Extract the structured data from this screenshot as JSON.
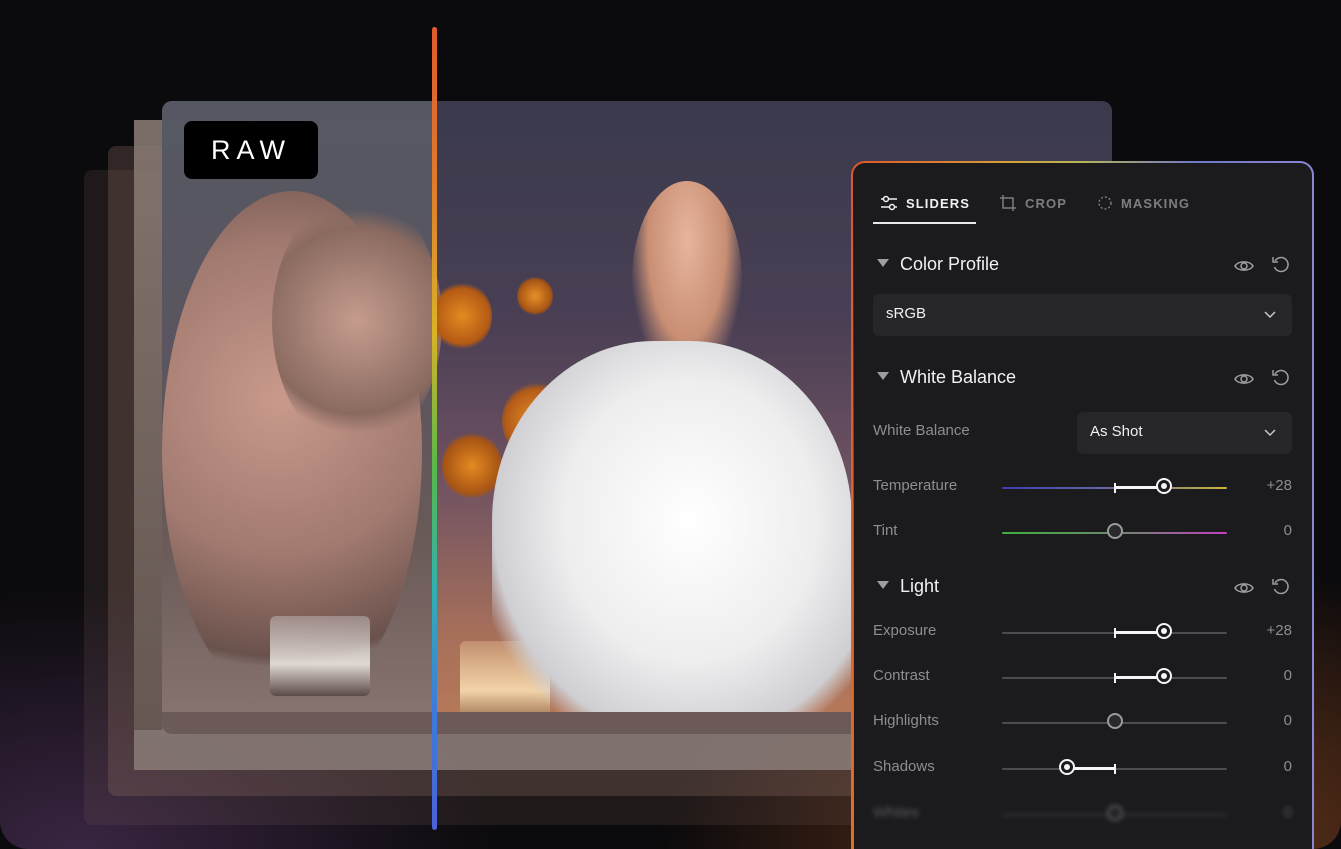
{
  "raw_badge": "RAW",
  "tabs": [
    {
      "label": "SLIDERS",
      "icon": "sliders-icon",
      "active": true
    },
    {
      "label": "CROP",
      "icon": "crop-icon",
      "active": false
    },
    {
      "label": "MASKING",
      "icon": "masking-icon",
      "active": false
    }
  ],
  "color_profile": {
    "title": "Color Profile",
    "selected": "sRGB"
  },
  "white_balance": {
    "title": "White Balance",
    "preset_label": "White Balance",
    "preset_value": "As Shot",
    "temperature": {
      "label": "Temperature",
      "value": "+28"
    },
    "tint": {
      "label": "Tint",
      "value": "0"
    }
  },
  "light": {
    "title": "Light",
    "exposure": {
      "label": "Exposure",
      "value": "+28"
    },
    "contrast": {
      "label": "Contrast",
      "value": "0"
    },
    "highlights": {
      "label": "Highlights",
      "value": "0"
    },
    "shadows": {
      "label": "Shadows",
      "value": "0"
    },
    "whites": {
      "label": "Whites",
      "value": "0"
    }
  },
  "colors": {
    "panel_bg": "#1b1b1d",
    "temperature_track": [
      "#3b3fb0",
      "#c9b43a"
    ],
    "tint_track": [
      "#3fae3f",
      "#c23fc4"
    ],
    "split_line": [
      "#e05a2c",
      "#d9b326",
      "#56b949",
      "#3b7be0"
    ]
  }
}
